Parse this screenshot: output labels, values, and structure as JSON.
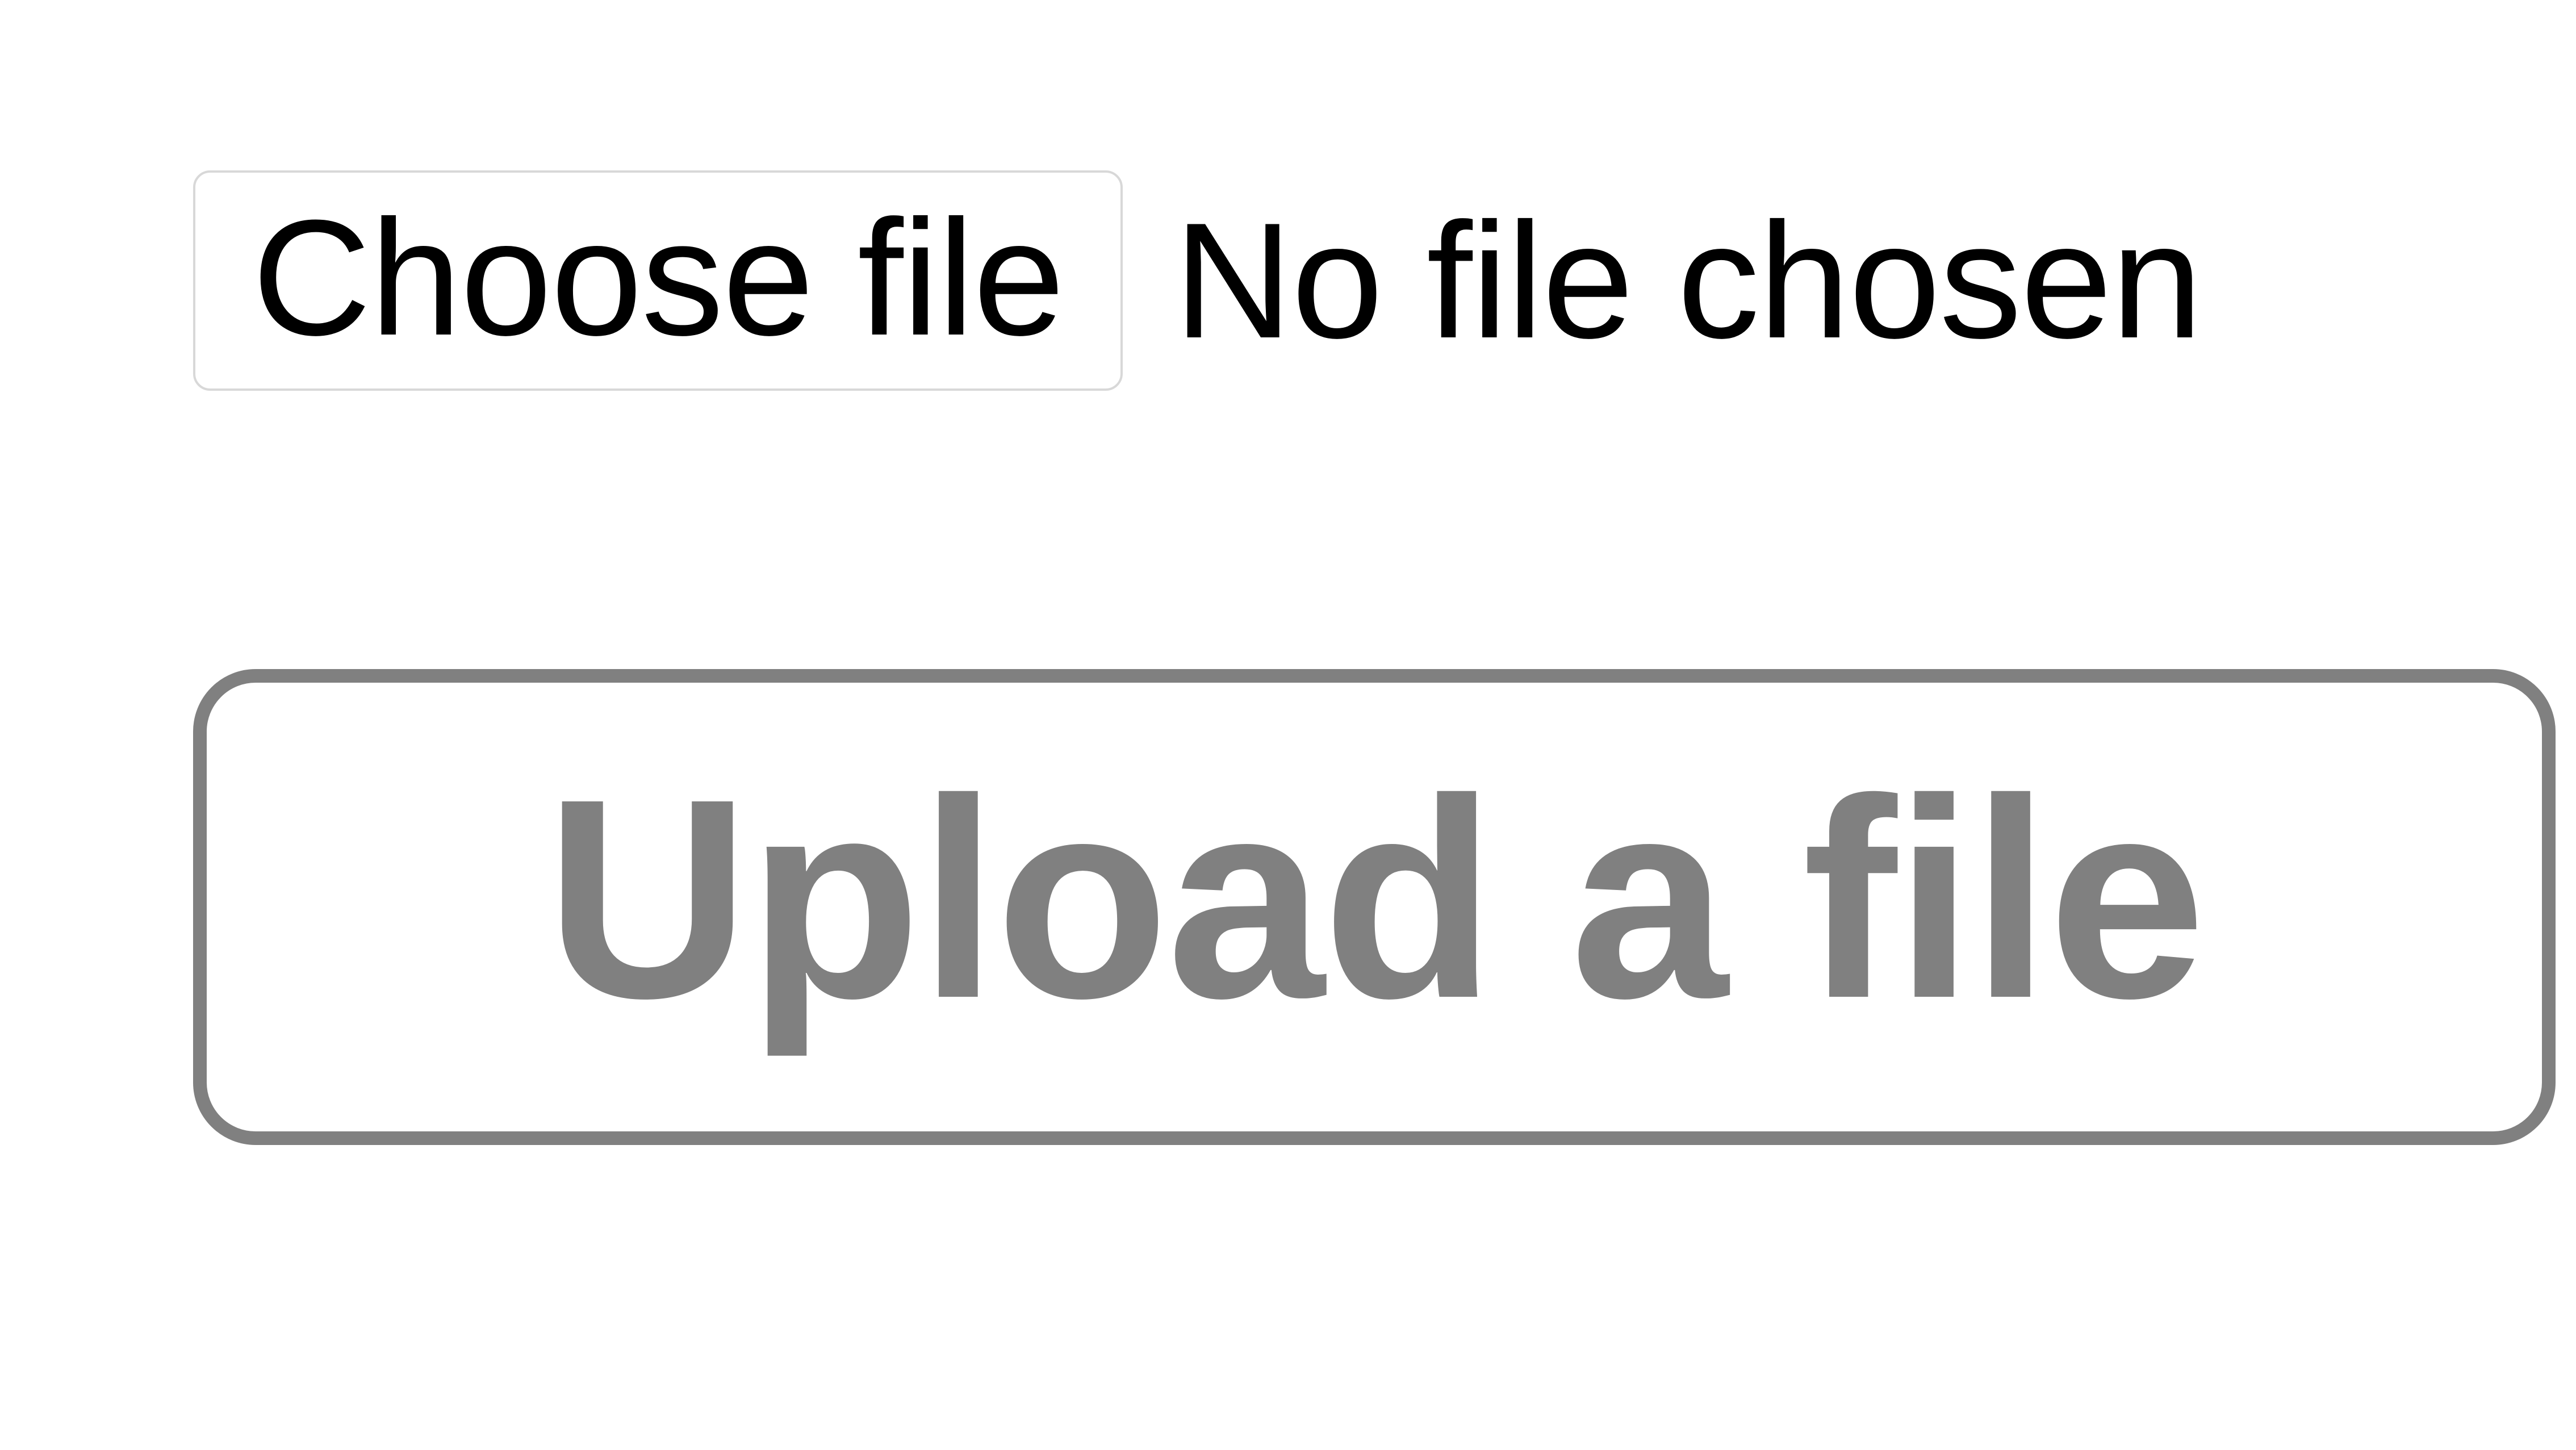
{
  "file_input": {
    "choose_button_label": "Choose file",
    "status_text": "No file chosen"
  },
  "upload_button": {
    "label": "Upload a file"
  }
}
